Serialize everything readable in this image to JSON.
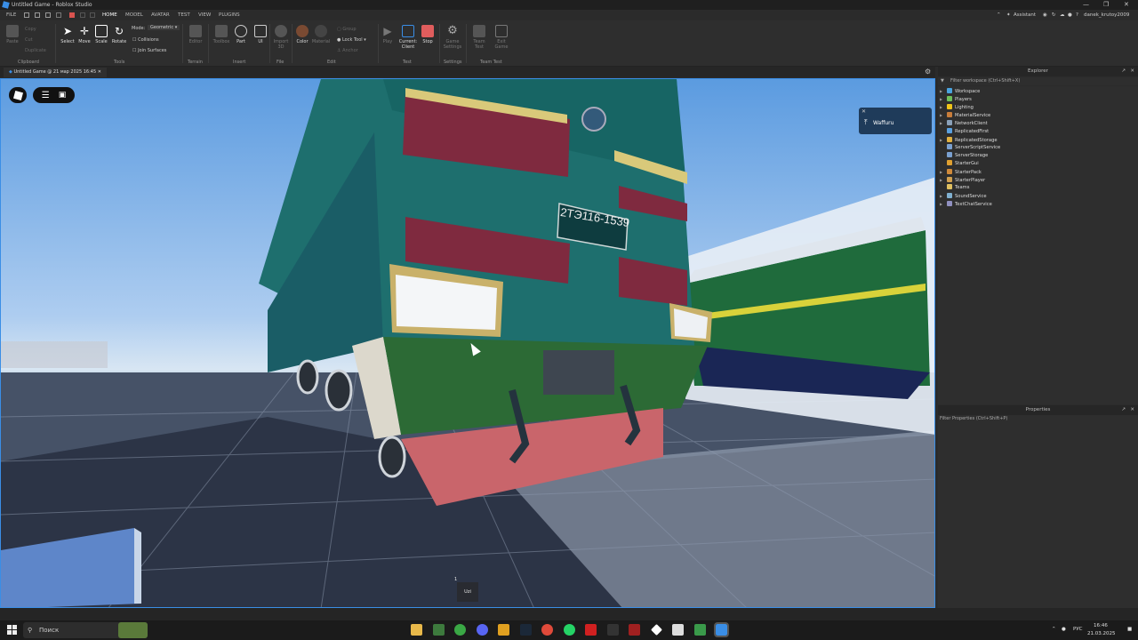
{
  "window": {
    "title": "Untitled Game - Roblox Studio"
  },
  "menu": {
    "file": "FILE",
    "tabs": [
      "HOME",
      "MODEL",
      "AVATAR",
      "TEST",
      "VIEW",
      "PLUGINS"
    ],
    "active_tab": "HOME",
    "assistant": "Assistant",
    "username": "danek_krutoy2009"
  },
  "ribbon": {
    "clipboard": {
      "paste": "Paste",
      "copy": "Copy",
      "cut": "Cut",
      "duplicate": "Duplicate",
      "label": "Clipboard"
    },
    "tools": {
      "select": "Select",
      "move": "Move",
      "scale": "Scale",
      "rotate": "Rotate",
      "mode_label": "Mode:",
      "mode_value": "Geometric",
      "collisions": "Collisions",
      "join_surfaces": "Join Surfaces",
      "label": "Tools"
    },
    "terrain": {
      "editor": "Editor",
      "label": "Terrain"
    },
    "insert": {
      "toolbox": "Toolbox",
      "part": "Part",
      "ui": "UI",
      "label": "Insert"
    },
    "file": {
      "import_3d": "Import 3D",
      "label": "File"
    },
    "edit": {
      "color": "Color",
      "material": "Material",
      "group": "Group",
      "lock_tool": "Lock Tool",
      "anchor": "Anchor",
      "label": "Edit"
    },
    "test": {
      "play": "Play",
      "current_client": "Current: Client",
      "stop": "Stop",
      "label": "Test"
    },
    "settings": {
      "game_settings": "Game Settings",
      "label": "Settings"
    },
    "team_test": {
      "team_test": "Team Test",
      "exit_game": "Exit Game",
      "label": "Team Test"
    }
  },
  "doc_tab": {
    "label": "Untitled Game @ 21 мар 2025 16:45"
  },
  "viewport": {
    "toast_user": "Waffuru",
    "plate_text": "2ТЭ116-1539",
    "bottom_hint_num": "1",
    "bottom_hint_key": "Uzi"
  },
  "explorer": {
    "title": "Explorer",
    "filter": "Filter workspace (Ctrl+Shift+X)",
    "items": [
      {
        "name": "Workspace",
        "color": "#4aa3df",
        "expandable": true
      },
      {
        "name": "Players",
        "color": "#6fbf5a",
        "expandable": true
      },
      {
        "name": "Lighting",
        "color": "#f0c419",
        "expandable": true
      },
      {
        "name": "MaterialService",
        "color": "#c97d3a",
        "expandable": true
      },
      {
        "name": "NetworkClient",
        "color": "#8aa0b8",
        "expandable": true
      },
      {
        "name": "ReplicatedFirst",
        "color": "#5aa0e0",
        "expandable": false
      },
      {
        "name": "ReplicatedStorage",
        "color": "#e0b040",
        "expandable": true
      },
      {
        "name": "ServerScriptService",
        "color": "#7aa0d0",
        "expandable": false
      },
      {
        "name": "ServerStorage",
        "color": "#7aa0d0",
        "expandable": false
      },
      {
        "name": "StarterGui",
        "color": "#e0a030",
        "expandable": false
      },
      {
        "name": "StarterPack",
        "color": "#d08a3a",
        "expandable": true
      },
      {
        "name": "StarterPlayer",
        "color": "#d0a050",
        "expandable": true
      },
      {
        "name": "Teams",
        "color": "#e0c060",
        "expandable": false
      },
      {
        "name": "SoundService",
        "color": "#80b0d0",
        "expandable": true
      },
      {
        "name": "TextChatService",
        "color": "#9090c0",
        "expandable": true
      }
    ]
  },
  "properties": {
    "title": "Properties",
    "filter": "Filter Properties (Ctrl+Shift+P)"
  },
  "taskbar": {
    "search": "Поиск",
    "lang": "РУС",
    "time": "16:46",
    "date": "21.03.2025"
  }
}
